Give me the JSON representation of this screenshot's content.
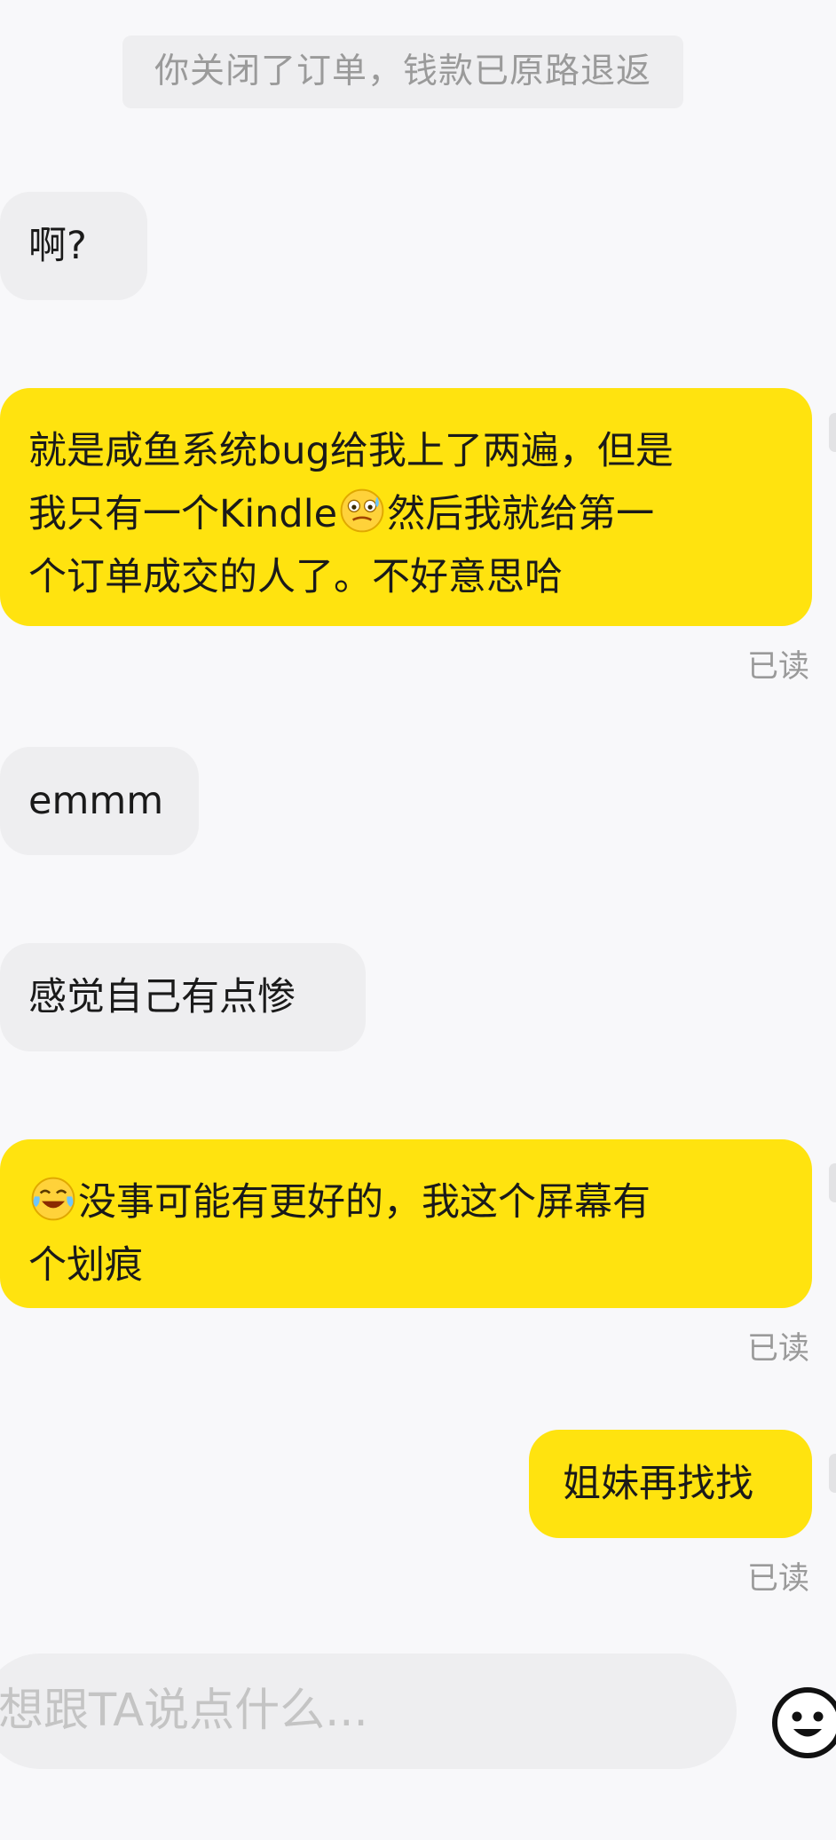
{
  "system_notice": "你关闭了订单，钱款已原路退返",
  "messages": [
    {
      "side": "incoming",
      "text": "啊?"
    },
    {
      "side": "outgoing",
      "lines": [
        "就是咸鱼系统bug给我上了两遍，但是",
        "我只有一个Kindle",
        "然后我就给第一",
        "个订单成交的人了。不好意思哈"
      ],
      "emoji": "sweat-smile-emoji",
      "status": "已读"
    },
    {
      "side": "incoming",
      "text": "emmm"
    },
    {
      "side": "incoming",
      "text": "感觉自己有点惨"
    },
    {
      "side": "outgoing",
      "lines": [
        "没事可能有更好的，我这个屏幕有",
        "个划痕"
      ],
      "emoji": "tears-of-joy-emoji",
      "status": "已读"
    },
    {
      "side": "outgoing",
      "text": "姐妹再找找",
      "status": "已读"
    }
  ],
  "composer": {
    "placeholder": "想跟TA说点什么..."
  },
  "icons": {
    "composer_emoji": "smiley-face-icon"
  },
  "colors": {
    "outgoing_bubble": "#ffe30f",
    "incoming_bubble": "#eeeef0",
    "background": "#f8f8fa",
    "muted_text": "#9a9a9a"
  }
}
